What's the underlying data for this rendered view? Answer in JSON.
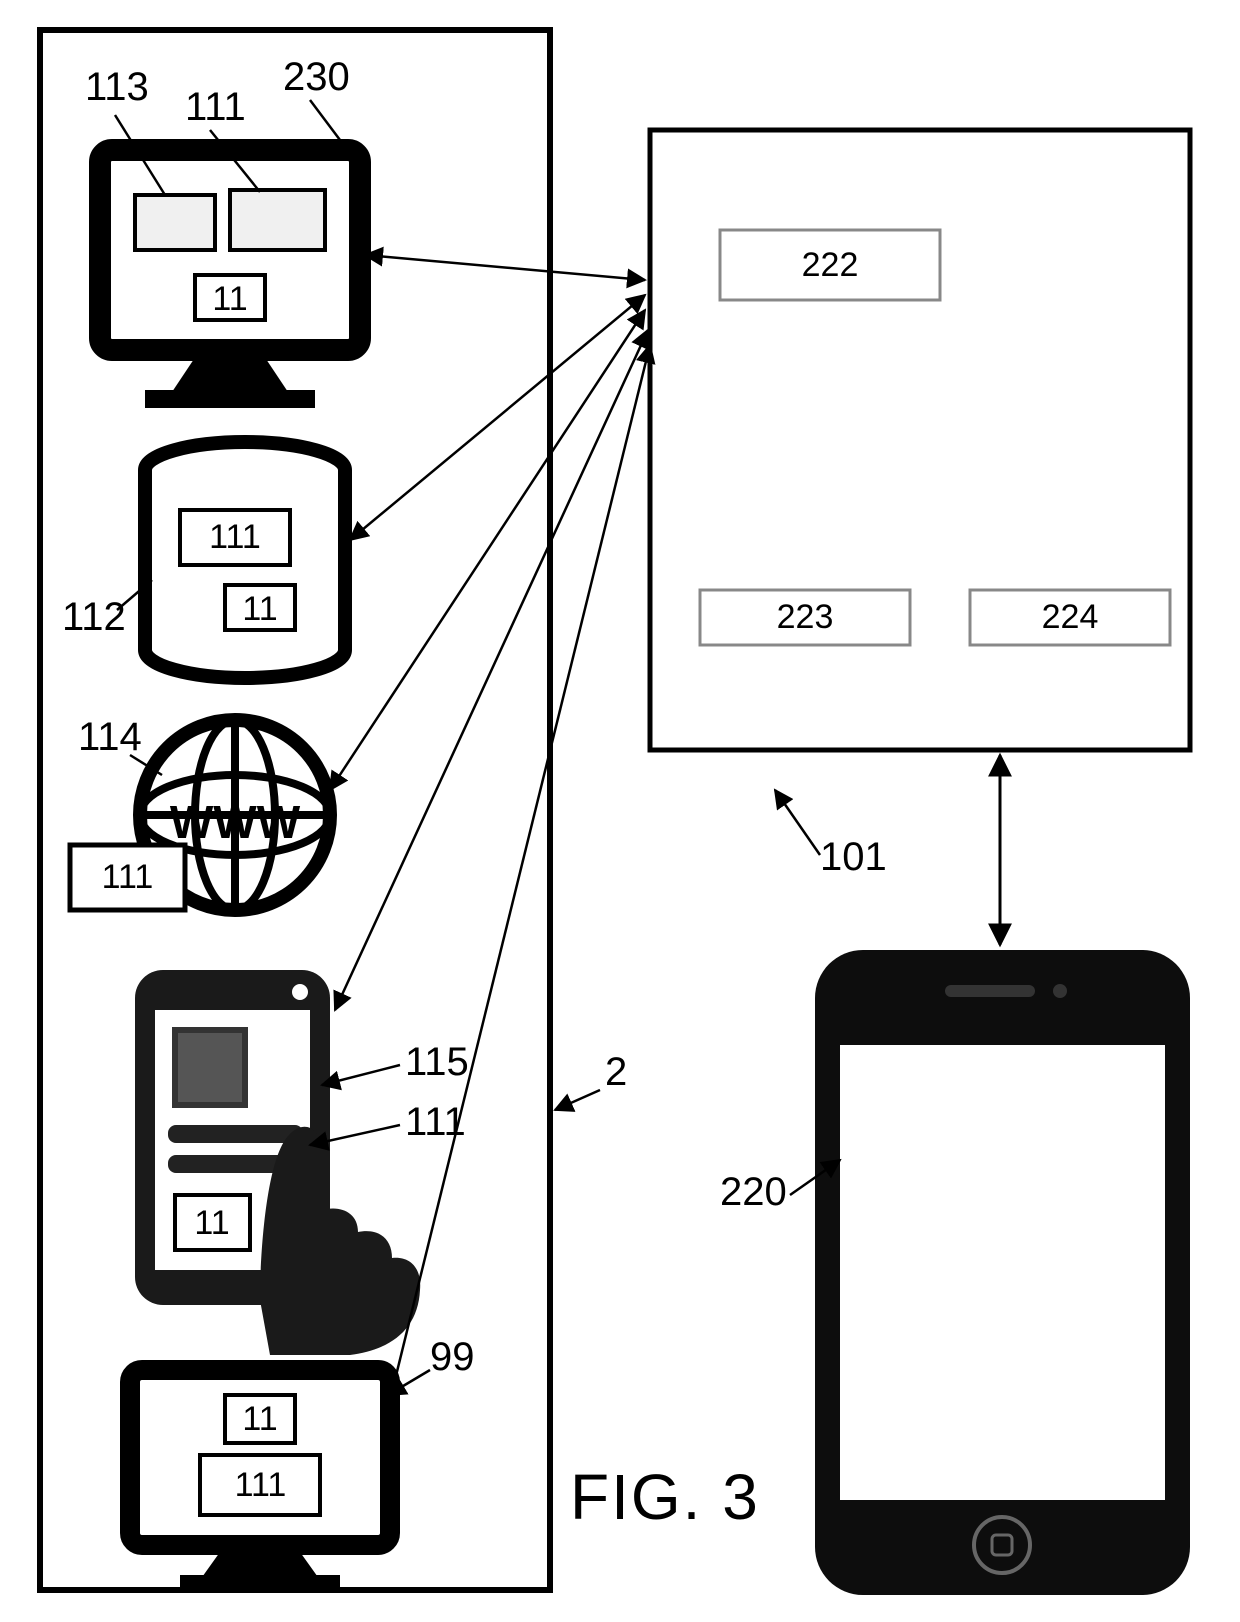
{
  "figure_caption": "FIG.  3",
  "refs": {
    "r113": "113",
    "r111_top": "111",
    "r230": "230",
    "r112": "112",
    "r114": "114",
    "r115": "115",
    "r111_mid": "111",
    "r99": "99",
    "r2": "2",
    "r101": "101",
    "r220": "220"
  },
  "box_labels": {
    "monitor1_inner_11": "11",
    "db_111": "111",
    "db_11": "11",
    "www_111": "111",
    "phone_11": "11",
    "monitor2_11": "11",
    "monitor2_111": "111",
    "server_222": "222",
    "server_223": "223",
    "server_224": "224"
  },
  "www_text": "WWW",
  "diagram": {
    "type": "system-block-diagram",
    "description": "Left column (container 2) holds data sources: computer 230 with components 113,111,11; database 112 with 111,11; web 114 with 111; mobile app 115 with 111,11; computer 99 with 11,111. All connect via arrows to server block 101 containing modules 222, 223, 224. Server 101 connects bidirectionally to smartphone 220."
  }
}
